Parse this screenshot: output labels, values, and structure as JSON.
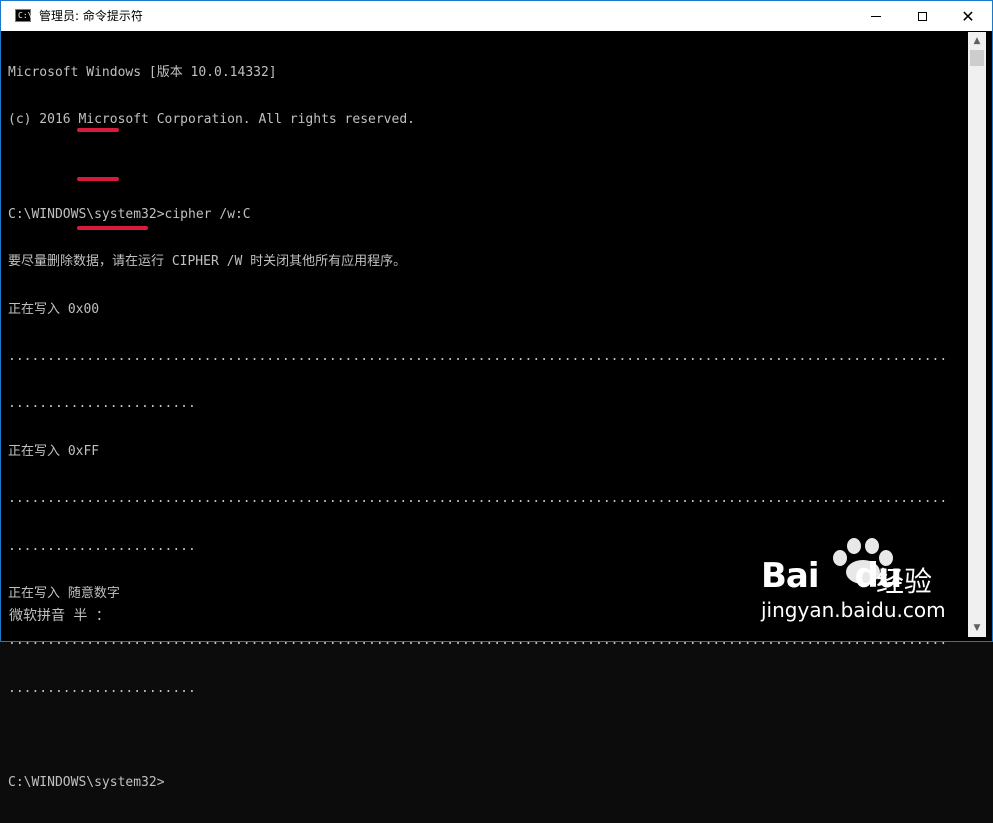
{
  "window": {
    "title": "管理员: 命令提示符",
    "icon_label": "C:\\",
    "accent_color": "#1979ca"
  },
  "controls": {
    "minimize": "minimize-icon",
    "maximize": "maximize-icon",
    "close": "close-icon"
  },
  "console": {
    "lines": [
      "Microsoft Windows [版本 10.0.14332]",
      "(c) 2016 Microsoft Corporation. All rights reserved.",
      "",
      "C:\\WINDOWS\\system32>cipher /w:C",
      "要尽量删除数据，请在运行 CIPHER /W 时关闭其他所有应用程序。",
      "正在写入 0x00",
      "........................................................................................................................",
      "........................",
      "正在写入 0xFF",
      "........................................................................................................................",
      "........................",
      "正在写入 随意数字",
      "........................................................................................................................",
      "........................",
      "",
      "C:\\WINDOWS\\system32>"
    ],
    "text_color": "#c0c0c0",
    "background": "#000000",
    "highlight_color": "#d81b3c"
  },
  "ime": {
    "status": "微软拼音 半 ："
  },
  "watermark": {
    "brand": "Bai",
    "brand_suffix": "du",
    "cn": "经验",
    "url": "jingyan.baidu.com"
  }
}
